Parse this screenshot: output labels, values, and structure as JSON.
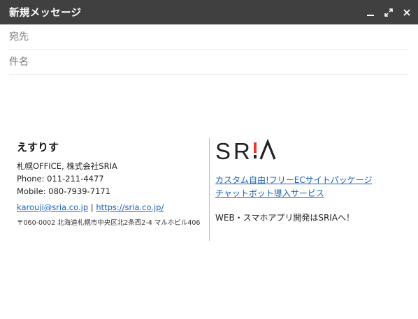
{
  "window": {
    "title": "新規メッセージ"
  },
  "fields": {
    "to_placeholder": "宛先",
    "subject_placeholder": "件名"
  },
  "signature": {
    "name": "えすりす",
    "company": "札幌OFFICE, 株式会社SRIA",
    "phone": "Phone: 011-211-4477",
    "mobile": "Mobile: 080-7939-7171",
    "email": "karouji@sria.co.jp",
    "separator": " | ",
    "website": "https://sria.co.jp/",
    "address": "〒060-0002 北海道札幌市中央区北2条西2-4 マルホビル406",
    "logo_text": "SRIA",
    "link1": "カスタム自由!フリーECサイトパッケージ",
    "link2": "チャットボット導入サービス",
    "tagline": "WEB・スマホアプリ開発はSRIAへ！"
  },
  "colors": {
    "titlebar": "#404040",
    "link": "#1a5fb4"
  }
}
